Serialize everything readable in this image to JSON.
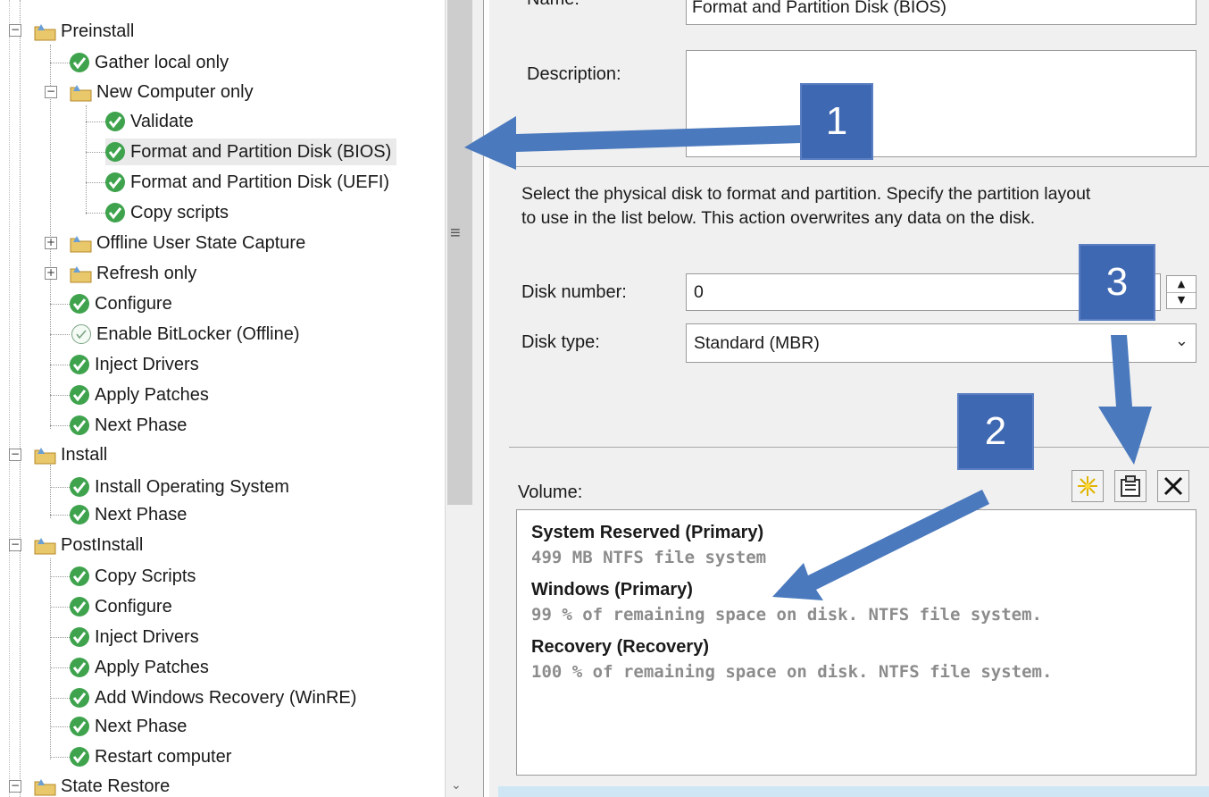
{
  "tree": {
    "items": [
      {
        "label": "Preinstall",
        "type": "folder"
      },
      {
        "label": "Gather local only",
        "type": "step"
      },
      {
        "label": "New Computer only",
        "type": "folder"
      },
      {
        "label": "Validate",
        "type": "step"
      },
      {
        "label": "Format and Partition Disk (BIOS)",
        "type": "step",
        "selected": true
      },
      {
        "label": "Format and Partition Disk (UEFI)",
        "type": "step"
      },
      {
        "label": "Copy scripts",
        "type": "step"
      },
      {
        "label": "Offline User State Capture",
        "type": "folder"
      },
      {
        "label": "Refresh only",
        "type": "folder"
      },
      {
        "label": "Configure",
        "type": "step"
      },
      {
        "label": "Enable BitLocker (Offline)",
        "type": "step-disabled"
      },
      {
        "label": "Inject Drivers",
        "type": "step"
      },
      {
        "label": "Apply Patches",
        "type": "step"
      },
      {
        "label": "Next Phase",
        "type": "step"
      },
      {
        "label": "Install",
        "type": "folder"
      },
      {
        "label": "Install Operating System",
        "type": "step"
      },
      {
        "label": "Next Phase",
        "type": "step"
      },
      {
        "label": "PostInstall",
        "type": "folder"
      },
      {
        "label": "Copy Scripts",
        "type": "step"
      },
      {
        "label": "Configure",
        "type": "step"
      },
      {
        "label": "Inject Drivers",
        "type": "step"
      },
      {
        "label": "Apply Patches",
        "type": "step"
      },
      {
        "label": "Add Windows Recovery (WinRE)",
        "type": "step"
      },
      {
        "label": "Next Phase",
        "type": "step"
      },
      {
        "label": "Restart computer",
        "type": "step"
      },
      {
        "label": "State Restore",
        "type": "folder"
      }
    ]
  },
  "form": {
    "name_label": "Name:",
    "name_value": "Format and Partition Disk (BIOS)",
    "description_label": "Description:",
    "instructions_line1": "Select the physical disk to format and partition.  Specify the partition layout",
    "instructions_line2": "to use in the list below. This action overwrites any data on the disk.",
    "disk_number_label": "Disk number:",
    "disk_number_value": "0",
    "disk_type_label": "Disk type:",
    "disk_type_value": "Standard (MBR)",
    "volume_label": "Volume:"
  },
  "volumes": [
    {
      "title": "System Reserved (Primary)",
      "desc": "499 MB NTFS file system"
    },
    {
      "title": "Windows (Primary)",
      "desc": "99 % of remaining space on disk. NTFS file system."
    },
    {
      "title": "Recovery (Recovery)",
      "desc": "100 % of remaining space on disk. NTFS file system."
    }
  ],
  "annotations": {
    "badge1": "1",
    "badge2": "2",
    "badge3": "3"
  },
  "toolbar_icons": [
    "new-volume-icon",
    "properties-icon",
    "delete-icon"
  ],
  "colors": {
    "badge": "#3f68b3",
    "arrow": "#4a79bd",
    "check": "#3fa34d"
  }
}
